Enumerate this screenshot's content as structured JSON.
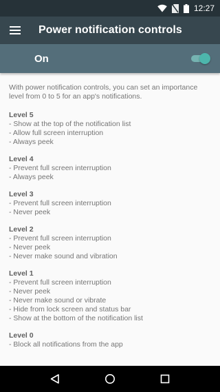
{
  "status_bar": {
    "time": "12:27",
    "icons": [
      "wifi-icon",
      "no-sim-icon",
      "battery-icon"
    ]
  },
  "app_bar": {
    "title": "Power notification controls",
    "menu_icon": "hamburger-menu-icon"
  },
  "master_switch": {
    "label": "On",
    "state": true,
    "accent_color": "#4db6ac"
  },
  "content": {
    "intro": "With power notification controls, you can set an importance level from 0 to 5 for an app's notifications.",
    "levels": [
      {
        "title": "Level 5",
        "items": [
          "- Show at the top of the notification list",
          "- Allow full screen interruption",
          "- Always peek"
        ]
      },
      {
        "title": "Level 4",
        "items": [
          "- Prevent full screen interruption",
          "- Always peek"
        ]
      },
      {
        "title": "Level 3",
        "items": [
          "- Prevent full screen interruption",
          "- Never peek"
        ]
      },
      {
        "title": "Level 2",
        "items": [
          "- Prevent full screen interruption",
          "- Never peek",
          "- Never make sound and vibration"
        ]
      },
      {
        "title": "Level 1",
        "items": [
          "- Prevent full screen interruption",
          "- Never peek",
          "- Never make sound or vibrate",
          "- Hide from lock screen and status bar",
          "- Show at the bottom of the notification list"
        ]
      },
      {
        "title": "Level 0",
        "items": [
          "- Block all notifications from the app"
        ]
      }
    ]
  },
  "nav_bar": {
    "buttons": [
      "back-icon",
      "home-icon",
      "recents-icon"
    ]
  },
  "colors": {
    "status_bar": "#263238",
    "app_bar": "#37474f",
    "switch_bar": "#546e7a",
    "background": "#fafafa"
  }
}
